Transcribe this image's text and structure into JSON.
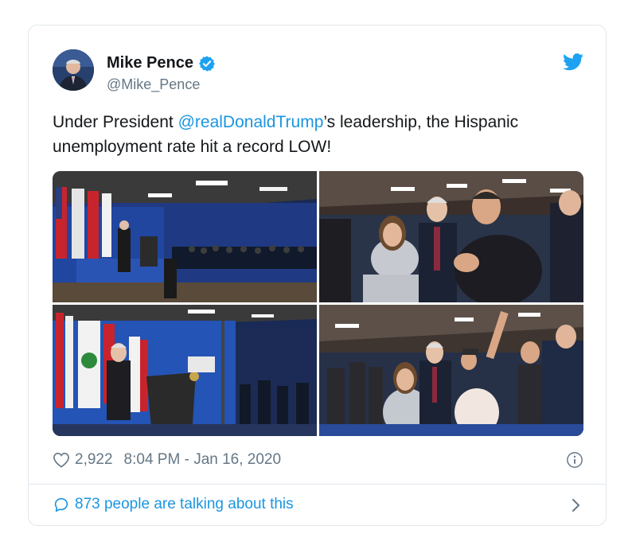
{
  "author": {
    "name": "Mike Pence",
    "handle": "@Mike_Pence"
  },
  "tweet": {
    "text_before": "Under President ",
    "mention": "@realDonaldTrump",
    "text_after": "’s leadership, the Hispanic unemployment rate hit a record LOW!"
  },
  "media": {
    "photos": [
      {
        "alt": "photo-1"
      },
      {
        "alt": "photo-2"
      },
      {
        "alt": "photo-3"
      },
      {
        "alt": "photo-4"
      }
    ]
  },
  "stats": {
    "likes": "2,922",
    "timestamp": "8:04 PM - Jan 16, 2020"
  },
  "footer": {
    "talking": "873 people are talking about this"
  },
  "colors": {
    "accent": "#1b95e0",
    "verified": "#1da1f2",
    "muted": "#657786",
    "border": "#e1e8ed"
  }
}
